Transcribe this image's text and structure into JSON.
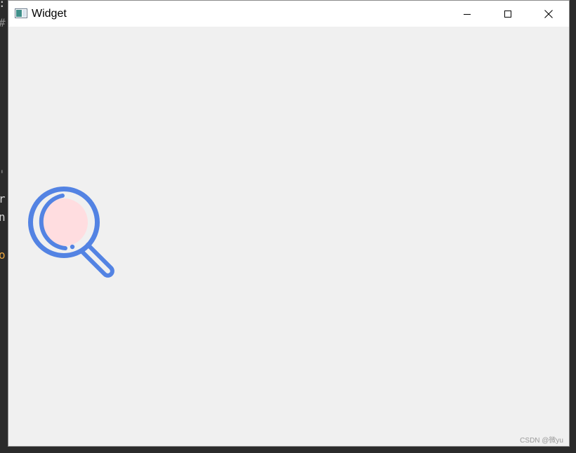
{
  "window": {
    "title": "Widget",
    "controls": {
      "minimize_icon": "minimize-icon",
      "maximize_icon": "maximize-icon",
      "close_icon": "close-icon"
    }
  },
  "content": {
    "icon": "magnifier-icon",
    "colors": {
      "ring": "#5383e3",
      "lens": "#ffdde0",
      "background": "#f0f0f0"
    }
  },
  "background_fragments": [
    {
      "text": ":",
      "color": "#cccccc"
    },
    {
      "text": "#",
      "color": "#888888"
    },
    {
      "text": "'",
      "color": "#888888"
    },
    {
      "text": "r",
      "color": "#d4d4d4"
    },
    {
      "text": "n",
      "color": "#d4d4d4"
    },
    {
      "text": "o",
      "color": "#e8a33d"
    }
  ],
  "watermark": "CSDN @微yu"
}
